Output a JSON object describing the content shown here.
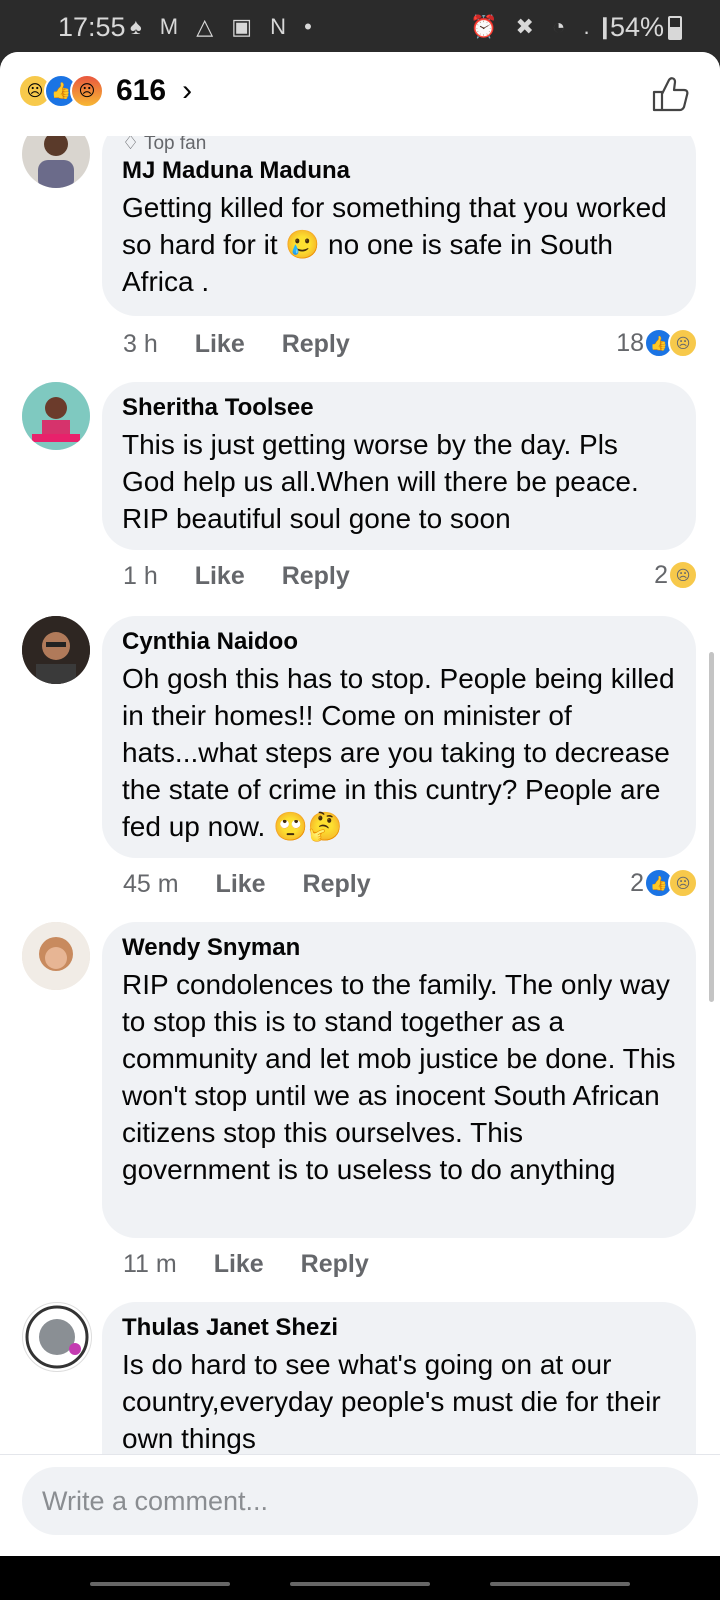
{
  "statusbar": {
    "time": "17:55",
    "battery": "54%",
    "left_icons": "♠ M △ ▣ N •",
    "right_icons": "⏰ ✖ ◔ .❙"
  },
  "header": {
    "reaction_count": "616",
    "chevron": "›"
  },
  "comments": [
    {
      "badge": "Top fan",
      "author": "MJ Maduna Maduna",
      "text": "Getting killed for something that you worked so hard for it 🥲 no one is safe in South Africa .",
      "time": "3 h",
      "like": "Like",
      "reply": "Reply",
      "reactions": "18"
    },
    {
      "author": "Sheritha Toolsee",
      "text": "This is just getting worse by the day. Pls God help us all.When will there be peace. RIP beautiful soul gone to soon",
      "time": "1 h",
      "like": "Like",
      "reply": "Reply",
      "reactions": "2"
    },
    {
      "author": "Cynthia Naidoo",
      "text": "Oh gosh this has to stop. People being killed in  their homes!! Come on minister of hats...what steps are you taking to decrease the state of crime in this cuntry?  People are fed up now. 🙄🤔",
      "time": "45 m",
      "like": "Like",
      "reply": "Reply",
      "reactions": "2"
    },
    {
      "author": "Wendy Snyman",
      "text": "RIP condolences to the family. The only way to stop this is to stand together as a community and let mob justice be done. This won't stop until we as inocent South African citizens stop this ourselves. This government is to useless to do anything",
      "time": "11 m",
      "like": "Like",
      "reply": "Reply"
    },
    {
      "author": "Thulas Janet Shezi",
      "text": "Is do hard to see what's going on at our country,everyday people's must die for their own things"
    }
  ],
  "composer": {
    "placeholder": "Write a comment..."
  },
  "colors": {
    "accent": "#1b74e4",
    "bubble": "#f0f2f5",
    "meta": "#65676b"
  }
}
